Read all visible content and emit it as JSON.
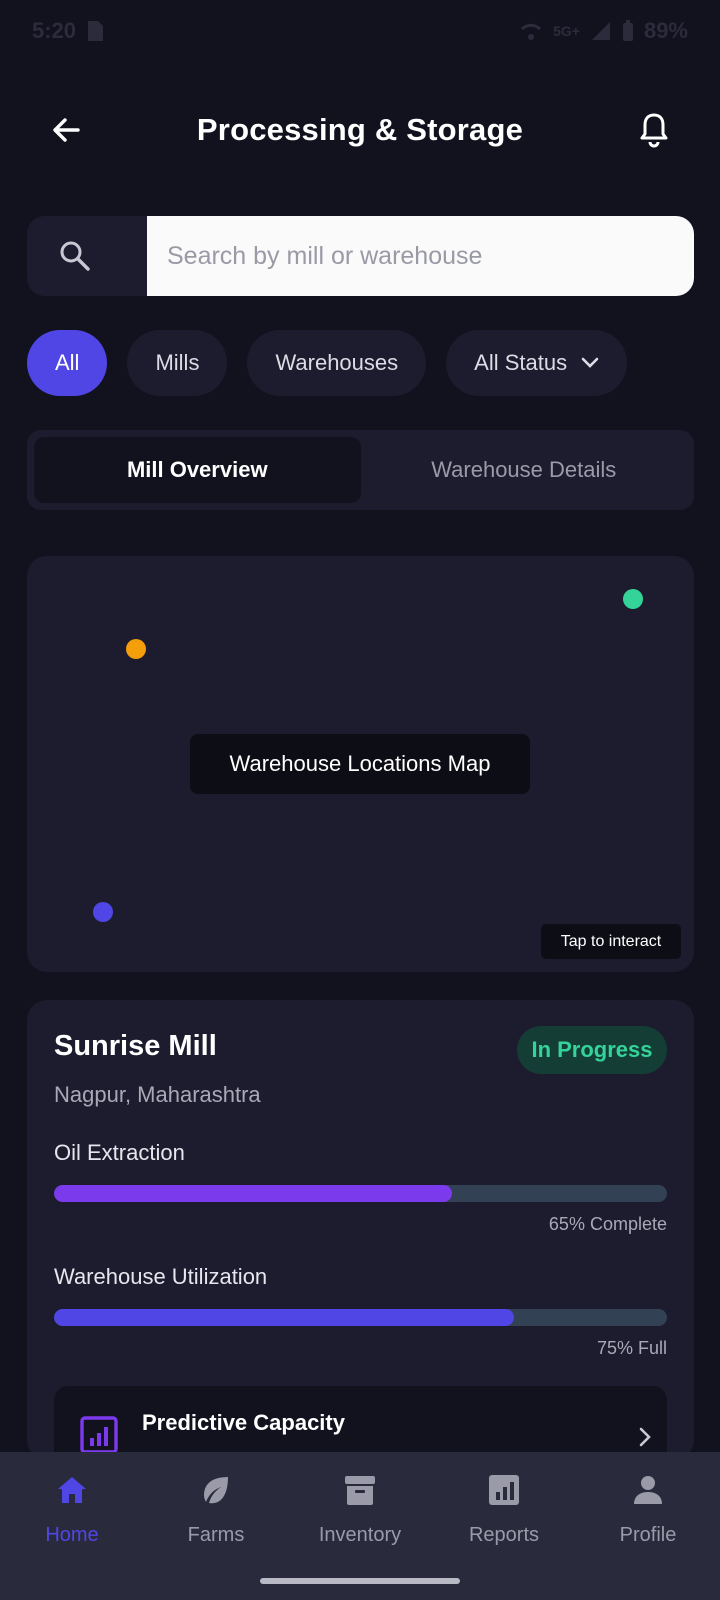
{
  "status_bar": {
    "time": "5:20",
    "network": "5G+",
    "battery": "89%"
  },
  "header": {
    "title": "Processing & Storage"
  },
  "search": {
    "placeholder": "Search by mill or warehouse"
  },
  "filters": [
    {
      "label": "All",
      "active": true
    },
    {
      "label": "Mills",
      "active": false
    },
    {
      "label": "Warehouses",
      "active": false
    },
    {
      "label": "All Status",
      "active": false,
      "dropdown": true
    }
  ],
  "tabs": [
    {
      "label": "Mill Overview",
      "active": true
    },
    {
      "label": "Warehouse Details",
      "active": false
    }
  ],
  "map": {
    "label": "Warehouse Locations Map",
    "hint": "Tap to interact",
    "markers": [
      {
        "color": "#34d399"
      },
      {
        "color": "#f59e0b"
      },
      {
        "color": "#4f46e5"
      }
    ]
  },
  "mill": {
    "name": "Sunrise Mill",
    "status": "In Progress",
    "location": "Nagpur, Maharashtra",
    "metrics": [
      {
        "label": "Oil Extraction",
        "value_text": "65% Complete",
        "percent": 65,
        "color": "#7c3aed"
      },
      {
        "label": "Warehouse Utilization",
        "value_text": "75% Full",
        "percent": 75,
        "color": "#4f46e5"
      }
    ],
    "predictive": {
      "title": "Predictive Capacity"
    }
  },
  "bottom_nav": [
    {
      "label": "Home",
      "icon": "home-icon",
      "active": true
    },
    {
      "label": "Farms",
      "icon": "leaf-icon",
      "active": false
    },
    {
      "label": "Inventory",
      "icon": "inventory-box-icon",
      "active": false
    },
    {
      "label": "Reports",
      "icon": "bar-chart-icon",
      "active": false
    },
    {
      "label": "Profile",
      "icon": "person-icon",
      "active": false
    }
  ],
  "colors": {
    "background": "#12121f",
    "surface": "#1c1c2e",
    "accent": "#4f46e5",
    "success": "#34d399"
  }
}
